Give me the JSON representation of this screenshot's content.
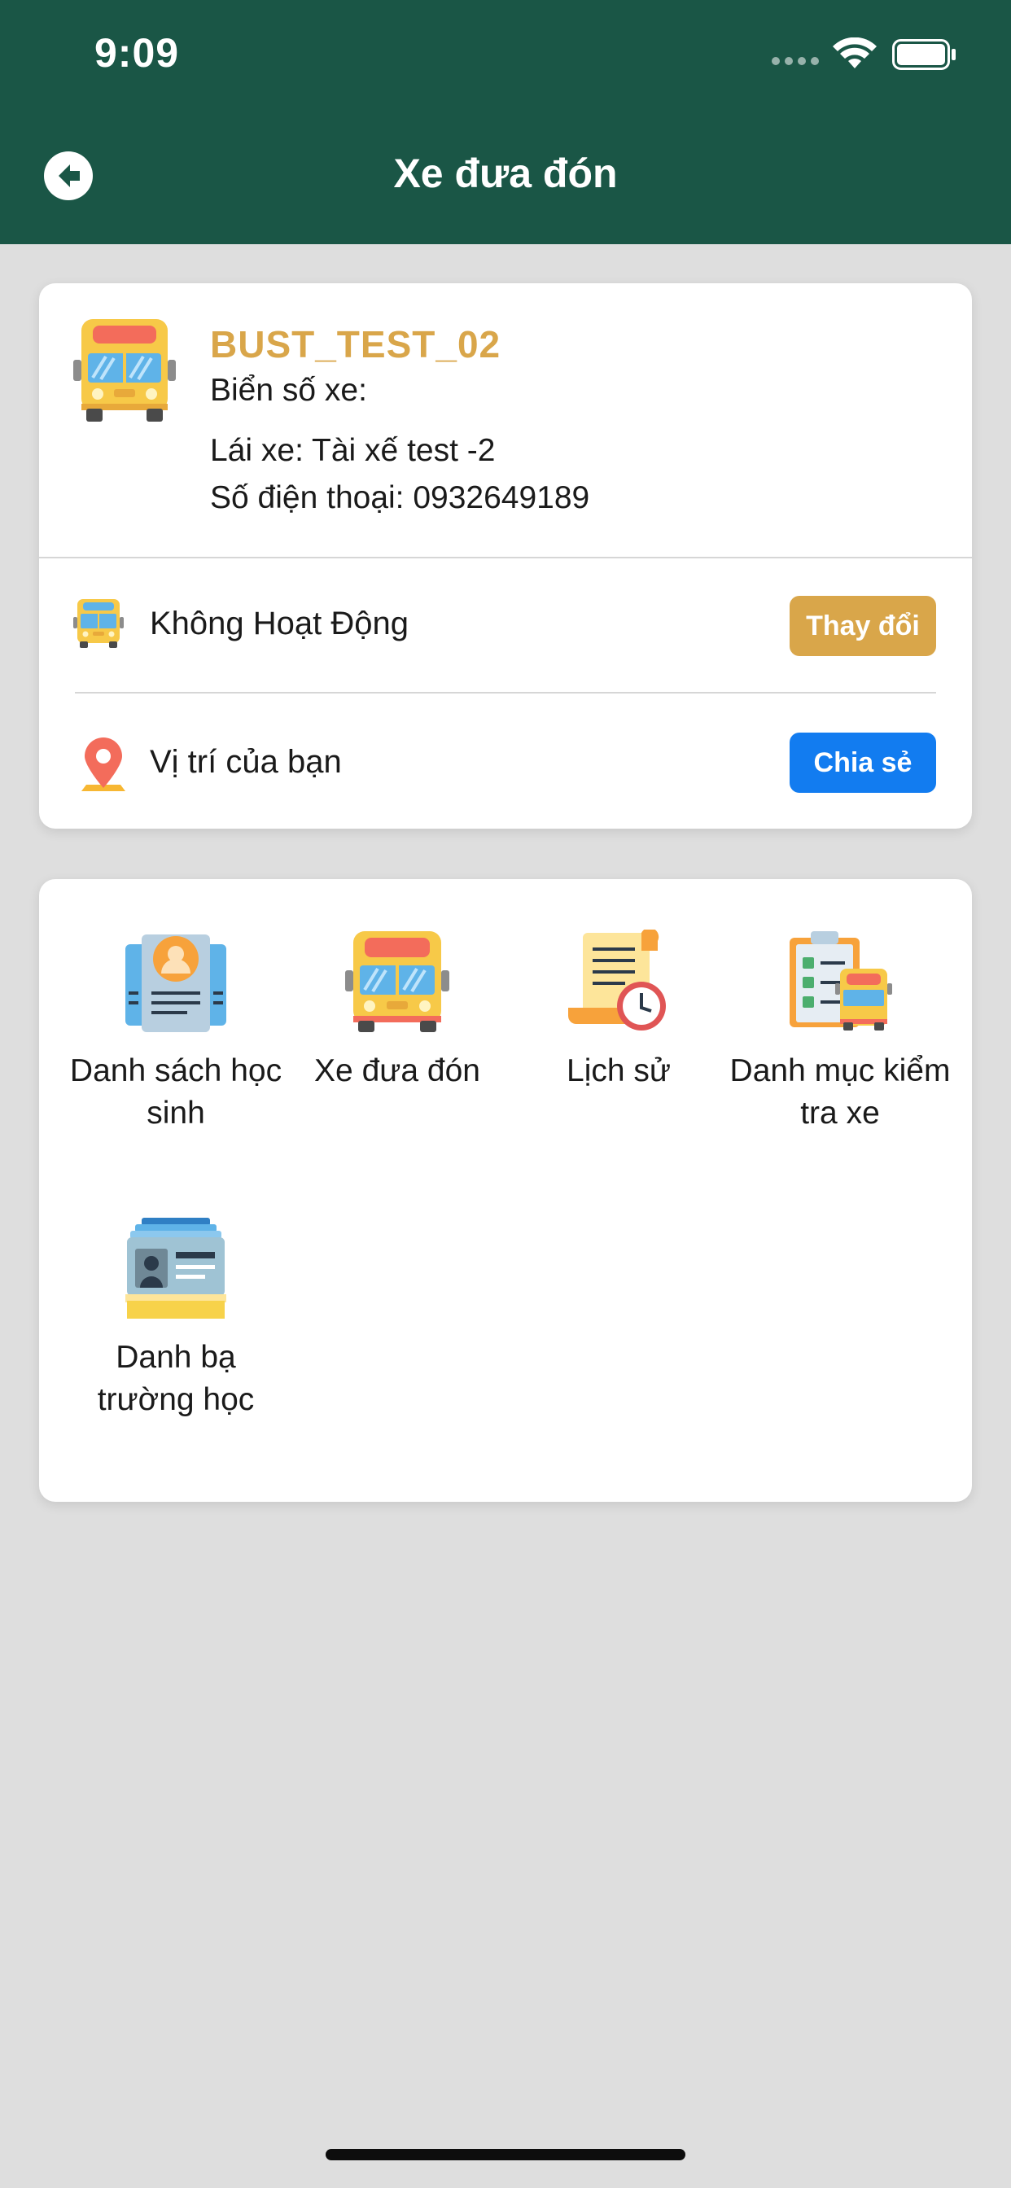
{
  "status_bar": {
    "time": "9:09"
  },
  "header": {
    "title": "Xe đưa đón"
  },
  "bus": {
    "name": "BUST_TEST_02",
    "plate_label": "Biển số xe:",
    "driver_text": "Lái xe: Tài xế test -2",
    "phone_text": "Số điện thoại: 0932649189"
  },
  "status_row": {
    "label": "Không Hoạt Động",
    "button": "Thay đổi"
  },
  "location_row": {
    "label": "Vị trí của bạn",
    "button": "Chia sẻ"
  },
  "menu": [
    {
      "label": "Danh sách học sinh",
      "icon": "student-list-icon"
    },
    {
      "label": "Xe đưa đón",
      "icon": "school-bus-icon"
    },
    {
      "label": "Lịch sử",
      "icon": "history-icon"
    },
    {
      "label": "Danh mục kiểm tra xe",
      "icon": "vehicle-checklist-icon"
    },
    {
      "label": "Danh bạ trường học",
      "icon": "school-contacts-icon"
    }
  ],
  "colors": {
    "header_bg": "#1a5646",
    "accent_gold": "#d9a64a",
    "share_blue": "#127cf0",
    "page_bg": "#dedede"
  }
}
